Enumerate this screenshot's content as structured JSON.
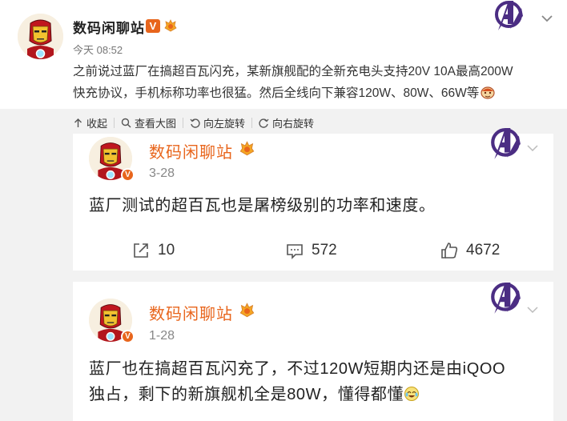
{
  "post": {
    "author": "数码闲聊站",
    "verified_badge": "V",
    "time": "今天 08:52",
    "text_line1": "之前说过蓝厂在搞超百瓦闪充，某新旗舰配的全新充电头支持20V 10A最高200W",
    "text_line2": "快充协议，手机标称功率也很猛。然后全线向下兼容120W、80W、66W等",
    "emoji": "doge-emoji",
    "menu_icon": "chevron-down-icon",
    "decor_icon": "avengers-logo"
  },
  "toolbar": {
    "collapse": "收起",
    "view_large": "查看大图",
    "rotate_left": "向左旋转",
    "rotate_right": "向右旋转"
  },
  "comments": [
    {
      "author": "数码闲聊站",
      "date": "3-28",
      "text": "蓝厂测试的超百瓦也是屠榜级别的功率和速度。",
      "verified_badge": "V",
      "reposts": "10",
      "comments": "572",
      "likes": "4672"
    },
    {
      "author": "数码闲聊站",
      "date": "1-28",
      "text_line1": "蓝厂也在搞超百瓦闪充了，不过120W短期内还是由iQOO",
      "text_line2": "独占，剩下的新旗舰机全是80W，懂得都懂",
      "verified_badge": "V",
      "emoji": "laugh-cry-emoji"
    }
  ],
  "colors": {
    "accent": "#e8651c",
    "avengers": "#4b2d83",
    "background": "#f2f2f2"
  }
}
